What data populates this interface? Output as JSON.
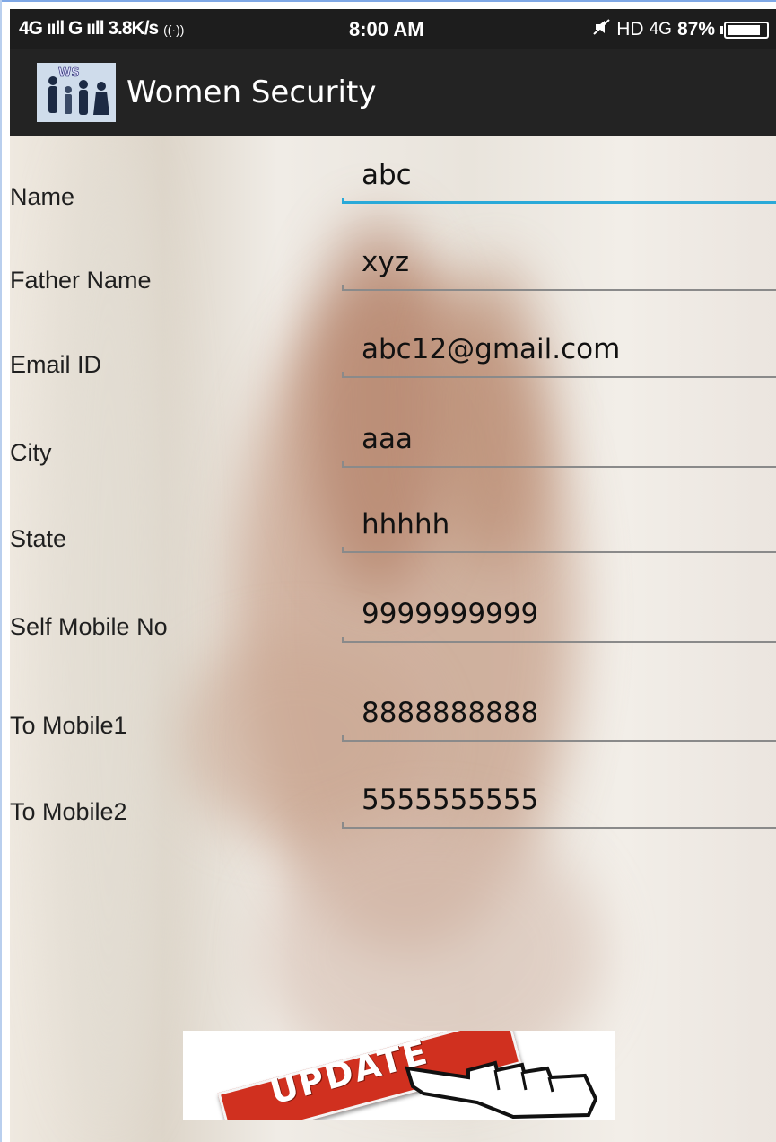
{
  "status_bar": {
    "left": "4G ııll G ııll 3.8K/s",
    "time": "8:00 AM",
    "hd": "HD",
    "network": "4G",
    "battery": "87%",
    "battery_level": 0.87
  },
  "app": {
    "title": "Women Security",
    "logo_icon": "women-security-logo-icon",
    "logo_text": "WS"
  },
  "form": {
    "fields": [
      {
        "label": "Name",
        "value": "abc"
      },
      {
        "label": "Father Name",
        "value": "xyz"
      },
      {
        "label": "Email ID",
        "value": "abc12@gmail.com"
      },
      {
        "label": "City",
        "value": "aaa"
      },
      {
        "label": "State",
        "value": "hhhhh"
      },
      {
        "label": "Self Mobile No",
        "value": "9999999999"
      },
      {
        "label": "To Mobile1",
        "value": "8888888888"
      },
      {
        "label": "To Mobile2",
        "value": "5555555555"
      }
    ],
    "update_button": "UPDATE"
  },
  "colors": {
    "accent": "#2aa9d8",
    "button_red": "#d0301f"
  }
}
